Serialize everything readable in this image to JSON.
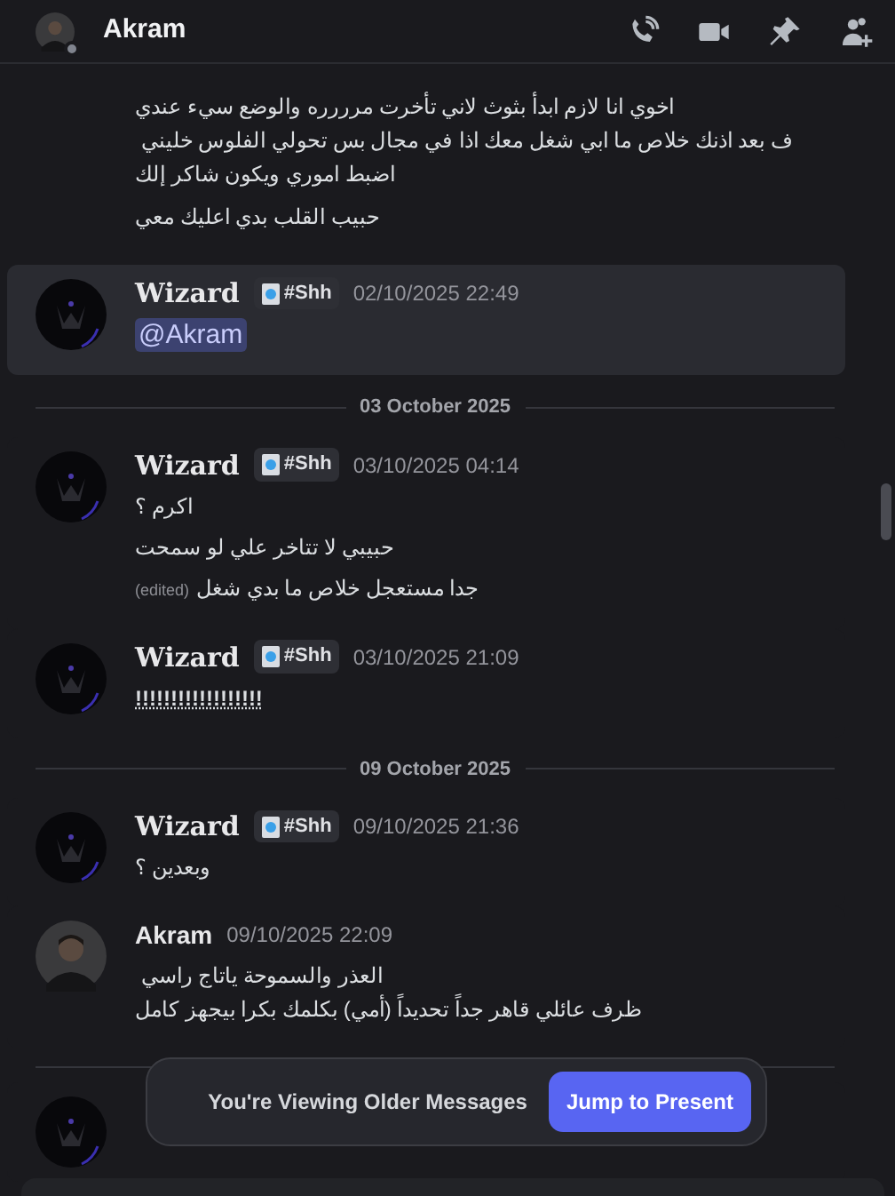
{
  "header": {
    "name": "Akram"
  },
  "messages": [
    {
      "kind": "continuation",
      "lines": [
        {
          "kind": "text",
          "text": "اخوي انا لازم ابدأ بثوث لاني تأخرت مرررره والوضع سيء عندي\nف بعد اذنك خلاص ما ابي شغل معك اذا في مجال بس تحولي الفلوس خليني \nاضبط اموري ويكون شاكر إلك"
        },
        {
          "kind": "text",
          "text": "حبيب القلب بدي اعليك معي"
        }
      ]
    },
    {
      "kind": "message",
      "author": "Wizard",
      "tag": "#Shh",
      "time": "02/10/2025 22:49",
      "highlighted": true,
      "lines": [
        {
          "kind": "mention",
          "text": "@Akram"
        }
      ]
    },
    {
      "kind": "divider",
      "text": "03 October 2025"
    },
    {
      "kind": "message",
      "author": "Wizard",
      "tag": "#Shh",
      "time": "03/10/2025 04:14",
      "highlighted": false,
      "lines": [
        {
          "kind": "text",
          "text": "اكرم ؟"
        },
        {
          "kind": "text",
          "text": "حبيبي لا تتاخر علي لو سمحت"
        },
        {
          "kind": "text",
          "text": "جدا مستعجل خلاص ما بدي شغل",
          "edited": "(edited)"
        }
      ]
    },
    {
      "kind": "message",
      "author": "Wizard",
      "tag": "#Shh",
      "time": "03/10/2025 21:09",
      "highlighted": false,
      "lines": [
        {
          "kind": "underlined",
          "text": "!!!!!!!!!!!!!!!!!!"
        }
      ]
    },
    {
      "kind": "divider",
      "text": "09 October 2025"
    },
    {
      "kind": "message",
      "author": "Wizard",
      "tag": "#Shh",
      "time": "09/10/2025 21:36",
      "highlighted": false,
      "lines": [
        {
          "kind": "text",
          "text": "وبعدين ؟"
        }
      ]
    },
    {
      "kind": "message",
      "author": "Akram",
      "time": "09/10/2025 22:09",
      "highlighted": false,
      "lines": [
        {
          "kind": "text",
          "text": "العذر والسموحة ياتاج راسي \nظرف عائلي قاهر جداً تحديداً (أمي) بكلمك بكرا بيجهز كامل"
        }
      ]
    },
    {
      "kind": "divider_hidden"
    },
    {
      "kind": "hidden"
    }
  ],
  "toast": {
    "text": "You're Viewing Older Messages",
    "button": "Jump to Present"
  }
}
